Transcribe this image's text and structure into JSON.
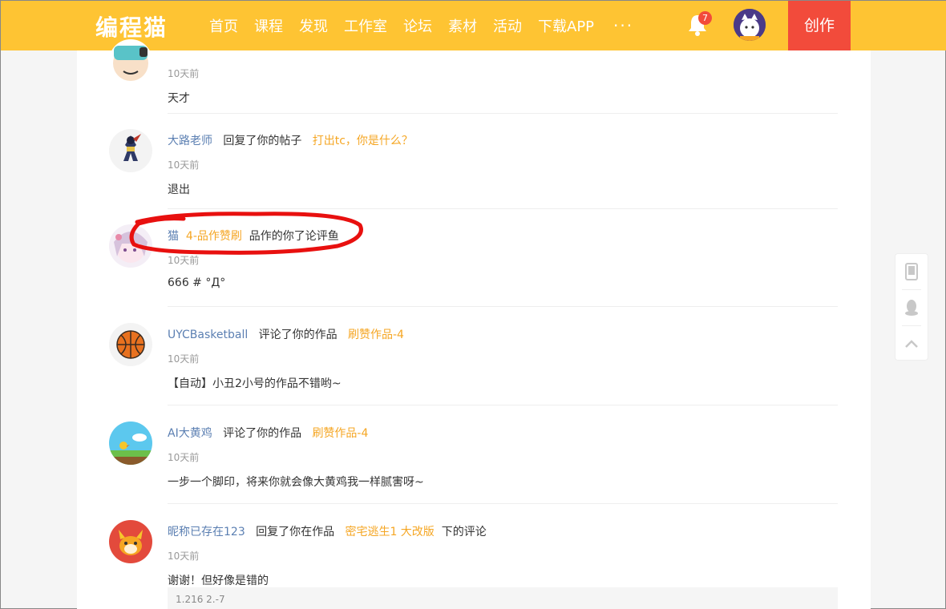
{
  "header": {
    "logo": "编程猫",
    "nav": [
      "首页",
      "课程",
      "发现",
      "工作室",
      "论坛",
      "素材",
      "活动",
      "下载APP"
    ],
    "more": "···",
    "bell_count": "7",
    "create_label": "创作"
  },
  "items": [
    {
      "time": "10天前",
      "message": "天才"
    },
    {
      "user": "大路老师",
      "action": "回复了你的帖子",
      "link": "打出tc，你是什么？",
      "time": "10天前",
      "message": "退出"
    },
    {
      "user": "猫",
      "link": "4-品作赞刷",
      "action": "品作的你了论评鱼",
      "time": "10天前",
      "message": "666 # °Д°"
    },
    {
      "user": "UYCBasketball",
      "action": "评论了你的作品",
      "link": "刷赞作品-4",
      "time": "10天前",
      "message": "【自动】小丑2小号的作品不错哟~"
    },
    {
      "user": "AI大黄鸡",
      "action": "评论了你的作品",
      "link": "刷赞作品-4",
      "time": "10天前",
      "message": "一步一个脚印，将来你就会像大黄鸡我一样腻害呀~"
    },
    {
      "user": "昵称已存在123",
      "action": "回复了你在作品",
      "link": "密宅逃生1 大改版",
      "suffix": "下的评论",
      "time": "10天前",
      "message": "谢谢！但好像是错的"
    }
  ],
  "quote": "1.216 2.-7",
  "colors": {
    "header": "#fec433",
    "create": "#f24b3b",
    "link": "#f5a623",
    "user": "#5b7fb2",
    "annotation": "#e8100f"
  },
  "side_icons": [
    "tablet-icon",
    "qq-icon",
    "back-to-top-icon"
  ]
}
